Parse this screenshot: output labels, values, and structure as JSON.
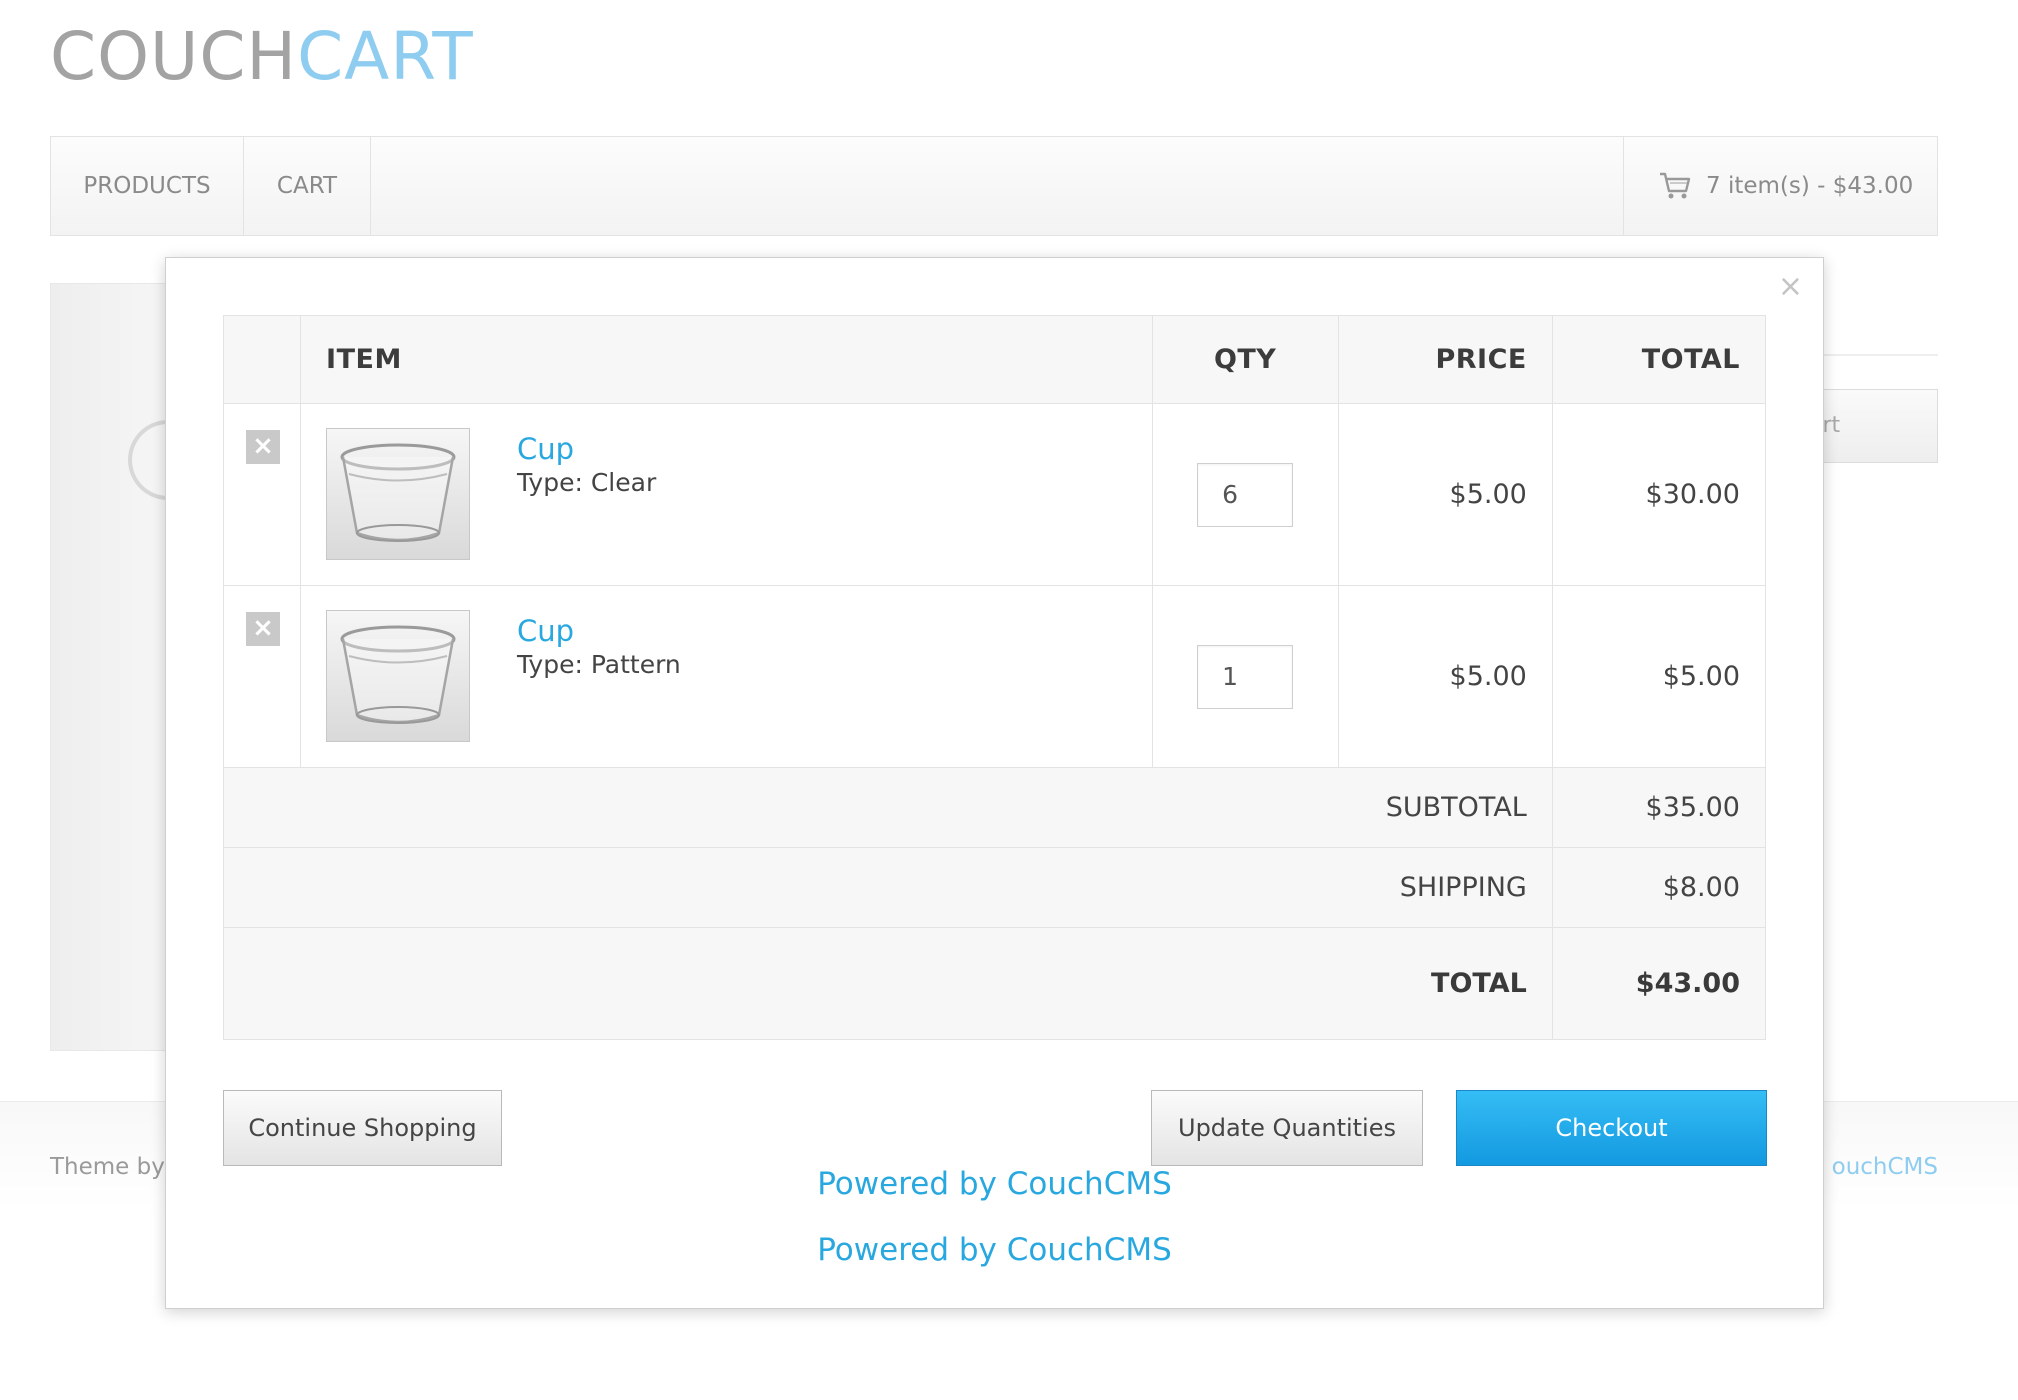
{
  "logo": {
    "part1": "COUCH",
    "part2": "CART"
  },
  "nav": {
    "items": [
      "PRODUCTS",
      "CART"
    ],
    "cart_summary": "7 item(s) - $43.00"
  },
  "background": {
    "button_partial": "art"
  },
  "footer": {
    "left": "Theme by",
    "right": "ouchCMS"
  },
  "modal": {
    "close": "×",
    "table": {
      "headers": {
        "item": "ITEM",
        "qty": "QTY",
        "price": "PRICE",
        "total": "TOTAL"
      },
      "rows": [
        {
          "remove": "×",
          "name": "Cup",
          "type": "Type: Clear",
          "qty": "6",
          "price": "$5.00",
          "total": "$30.00"
        },
        {
          "remove": "×",
          "name": "Cup",
          "type": "Type: Pattern",
          "qty": "1",
          "price": "$5.00",
          "total": "$5.00"
        }
      ],
      "subtotal_label": "SUBTOTAL",
      "subtotal": "$35.00",
      "shipping_label": "SHIPPING",
      "shipping": "$8.00",
      "total_label": "TOTAL",
      "total": "$43.00"
    },
    "buttons": {
      "continue": "Continue Shopping",
      "update": "Update Quantities",
      "checkout": "Checkout"
    },
    "powered": [
      "Powered by CouchCMS",
      "Powered by CouchCMS"
    ]
  },
  "colors": {
    "accent": "#29a8e0",
    "logo_light": "#8fcdf0",
    "checkout": "#1ea6ea"
  }
}
